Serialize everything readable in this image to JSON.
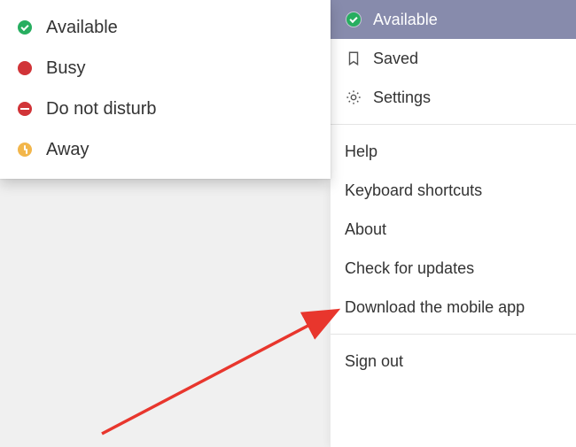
{
  "status_menu": {
    "items": [
      {
        "label": "Available"
      },
      {
        "label": "Busy"
      },
      {
        "label": "Do not disturb"
      },
      {
        "label": "Away"
      }
    ]
  },
  "settings_menu": {
    "status_label": "Available",
    "saved_label": "Saved",
    "settings_label": "Settings",
    "help_label": "Help",
    "keyboard_label": "Keyboard shortcuts",
    "about_label": "About",
    "updates_label": "Check for updates",
    "download_label": "Download the mobile app",
    "signout_label": "Sign out"
  }
}
